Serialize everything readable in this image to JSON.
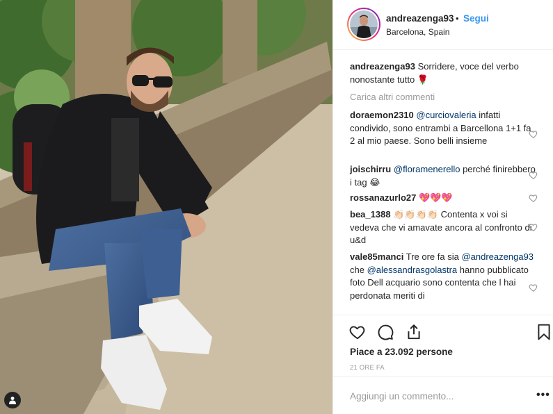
{
  "post": {
    "username": "andreazenga93",
    "follow_label": "Segui",
    "separator": "•",
    "location": "Barcelona, Spain",
    "caption_user": "andreazenga93",
    "caption_text": "Sorridere, voce del verbo nonostante tutto",
    "caption_emoji": "🌹",
    "load_more": "Carica altri commenti",
    "likes": "Piace a 23.092 persone",
    "time_ago": "21 ORE FA",
    "add_comment_placeholder": "Aggiungi un commento...",
    "more_options": "•••"
  },
  "comments": [
    {
      "user": "doraemon2310",
      "mention": "@curciovaleria",
      "text": "infatti condivido, sono entrambi a Barcellona 1+1 fa 2 al mio paese. Sono belli insieme"
    },
    {
      "user": "joischirru",
      "mention": "@floramenerello",
      "text": "perché finirebbero i tag",
      "emoji": "😂"
    },
    {
      "user": "rossanazurlo27",
      "emoji": "💖💖💖"
    },
    {
      "user": "bea_1388",
      "emoji": "👏🏻👏🏻👏🏻👏🏻",
      "text": "Contenta x voi si vedeva che vi amavate ancora al confronto di u&d"
    },
    {
      "user": "vale85manci",
      "text1": "Tre ore fa sia",
      "mention1": "@andreazenga93",
      "text2": "che",
      "mention2": "@alessandrasgolastra",
      "text3": "hanno pubblicato foto Dell acquario sono contenta che l hai perdonata meriti di"
    }
  ],
  "icons": {
    "like": "heart-outline-icon",
    "comment": "speech-bubble-icon",
    "share": "share-icon",
    "save": "bookmark-icon",
    "tag": "person-tag-icon"
  },
  "colors": {
    "accent": "#3897f0",
    "mention": "#003569",
    "muted": "#999999",
    "text": "#262626",
    "divider": "#efefef"
  }
}
